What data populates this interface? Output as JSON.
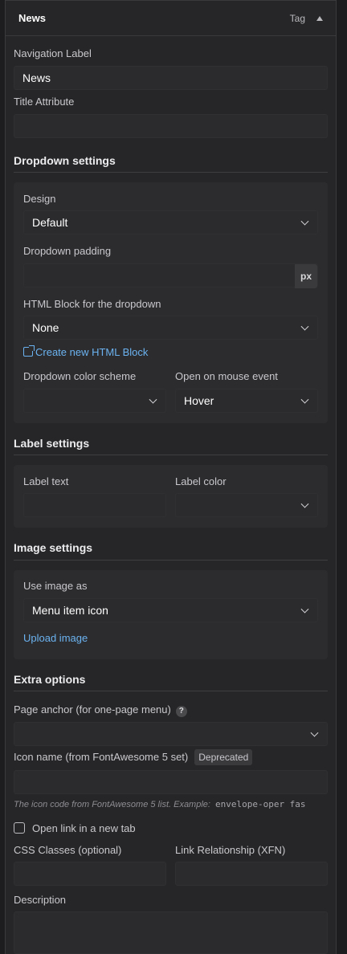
{
  "header": {
    "title": "News",
    "tag": "Tag"
  },
  "fields": {
    "navigation_label": {
      "label": "Navigation Label",
      "value": "News"
    },
    "title_attribute": {
      "label": "Title Attribute",
      "value": ""
    }
  },
  "dropdown_settings": {
    "title": "Dropdown settings",
    "design": {
      "label": "Design",
      "value": "Default"
    },
    "padding": {
      "label": "Dropdown padding",
      "value": "",
      "unit": "px"
    },
    "html_block": {
      "label": "HTML Block for the dropdown",
      "value": "None"
    },
    "create_link": "Create new HTML Block",
    "color_scheme": {
      "label": "Dropdown color scheme",
      "value": ""
    },
    "mouse_event": {
      "label": "Open on mouse event",
      "value": "Hover"
    }
  },
  "label_settings": {
    "title": "Label settings",
    "label_text": {
      "label": "Label text",
      "value": ""
    },
    "label_color": {
      "label": "Label color",
      "value": ""
    }
  },
  "image_settings": {
    "title": "Image settings",
    "use_image_as": {
      "label": "Use image as",
      "value": "Menu item icon"
    },
    "upload_link": "Upload image"
  },
  "extra_options": {
    "title": "Extra options",
    "page_anchor": {
      "label": "Page anchor (for one-page menu)",
      "help": "?",
      "value": ""
    },
    "icon_name": {
      "label": "Icon name (from FontAwesome 5 set)",
      "badge": "Deprecated",
      "value": ""
    },
    "icon_hint": "The icon code from FontAwesome 5 list. Example:",
    "icon_hint_code": "envelope-oper fas",
    "open_new_tab": "Open link in a new tab",
    "css_classes": {
      "label": "CSS Classes (optional)",
      "value": ""
    },
    "link_relationship": {
      "label": "Link Relationship (XFN)",
      "value": ""
    },
    "description": {
      "label": "Description",
      "value": ""
    }
  }
}
